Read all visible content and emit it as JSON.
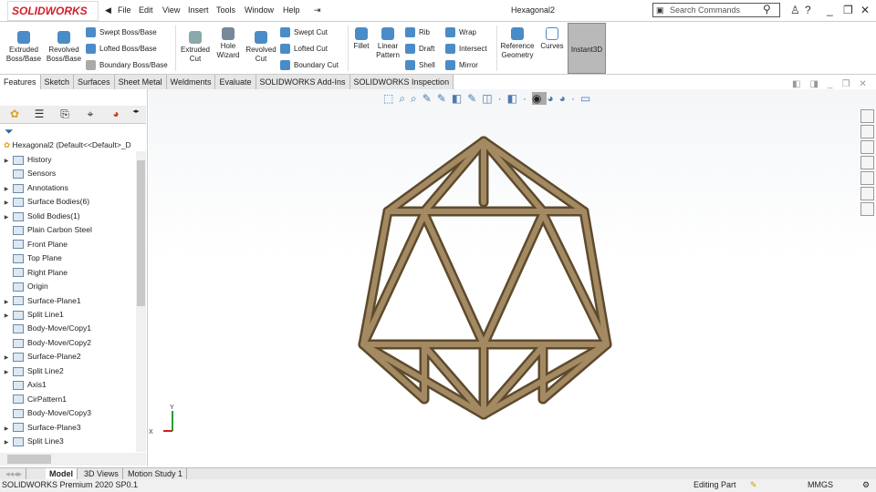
{
  "app": {
    "logo": "SOLIDWORKS",
    "title": "Hexagonal2",
    "search_placeholder": "Search Commands"
  },
  "menu": [
    "File",
    "Edit",
    "View",
    "Insert",
    "Tools",
    "Window",
    "Help"
  ],
  "ribbon": {
    "extruded_boss": "Extruded Boss/Base",
    "revolved_boss": "Revolved Boss/Base",
    "swept_boss": "Swept Boss/Base",
    "lofted_boss": "Lofted Boss/Base",
    "boundary_boss": "Boundary Boss/Base",
    "extruded_cut": "Extruded Cut",
    "hole_wizard": "Hole Wizard",
    "revolved_cut": "Revolved Cut",
    "swept_cut": "Swept Cut",
    "lofted_cut": "Lofted Cut",
    "boundary_cut": "Boundary Cut",
    "fillet": "Fillet",
    "linear_pattern": "Linear Pattern",
    "rib": "Rib",
    "draft": "Draft",
    "shell": "Shell",
    "wrap": "Wrap",
    "intersect": "Intersect",
    "mirror": "Mirror",
    "reference_geometry": "Reference Geometry",
    "curves": "Curves",
    "instant3d": "Instant3D"
  },
  "tabs": [
    "Features",
    "Sketch",
    "Surfaces",
    "Sheet Metal",
    "Weldments",
    "Evaluate",
    "SOLIDWORKS Add-Ins",
    "SOLIDWORKS Inspection"
  ],
  "tree": {
    "root": "Hexagonal2  (Default<<Default>_D",
    "items": [
      {
        "label": "History",
        "arrow": true
      },
      {
        "label": "Sensors",
        "arrow": false
      },
      {
        "label": "Annotations",
        "arrow": true
      },
      {
        "label": "Surface Bodies(6)",
        "arrow": true
      },
      {
        "label": "Solid Bodies(1)",
        "arrow": true
      },
      {
        "label": "Plain Carbon Steel",
        "arrow": false
      },
      {
        "label": "Front Plane",
        "arrow": false
      },
      {
        "label": "Top Plane",
        "arrow": false
      },
      {
        "label": "Right Plane",
        "arrow": false
      },
      {
        "label": "Origin",
        "arrow": false
      },
      {
        "label": "Surface-Plane1",
        "arrow": true
      },
      {
        "label": "Split Line1",
        "arrow": true
      },
      {
        "label": "Body-Move/Copy1",
        "arrow": false
      },
      {
        "label": "Body-Move/Copy2",
        "arrow": false
      },
      {
        "label": "Surface-Plane2",
        "arrow": true
      },
      {
        "label": "Split Line2",
        "arrow": true
      },
      {
        "label": "Axis1",
        "arrow": false
      },
      {
        "label": "CirPattern1",
        "arrow": false
      },
      {
        "label": "Body-Move/Copy3",
        "arrow": false
      },
      {
        "label": "Surface-Plane3",
        "arrow": true
      },
      {
        "label": "Split Line3",
        "arrow": true
      }
    ]
  },
  "bottom_tabs": [
    "Model",
    "3D Views",
    "Motion Study 1"
  ],
  "status": {
    "version": "SOLIDWORKS Premium 2020 SP0.1",
    "mode": "Editing Part",
    "units": "MMGS"
  },
  "triad": {
    "y": "Y",
    "x": "X"
  },
  "colors": {
    "beam_dark": "#5e4a2c",
    "beam_light": "#a38a63",
    "accent": "#d0202a"
  }
}
